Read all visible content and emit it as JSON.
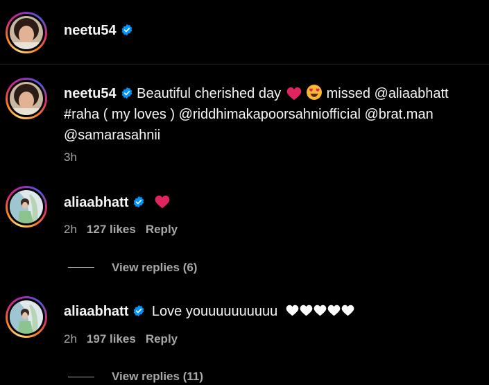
{
  "header": {
    "username": "neetu54"
  },
  "post": {
    "username": "neetu54",
    "caption_part1": "Beautiful cherished day",
    "caption_part2": "missed @aliaabhatt #raha ( my loves ) @riddhimakapoorsahniofficial @brat.man @samarasahnii",
    "timestamp": "3h"
  },
  "comments": [
    {
      "username": "aliaabhatt",
      "text": "",
      "time": "2h",
      "likes": "127 likes",
      "reply_label": "Reply",
      "view_replies": "View replies (6)",
      "emoji": [
        "red-heart"
      ]
    },
    {
      "username": "aliaabhatt",
      "text": "Love youuuuuuuuuu",
      "time": "2h",
      "likes": "197 likes",
      "reply_label": "Reply",
      "view_replies": "View replies (11)",
      "emoji": [
        "white-heart",
        "white-heart",
        "white-heart",
        "white-heart",
        "white-heart"
      ]
    }
  ],
  "colors": {
    "background": "#000000",
    "text_primary": "#f5f5f5",
    "text_secondary": "#a8a8a8",
    "verified_blue": "#0095f6",
    "heart_red": "#e0245e",
    "divider": "#262626"
  }
}
